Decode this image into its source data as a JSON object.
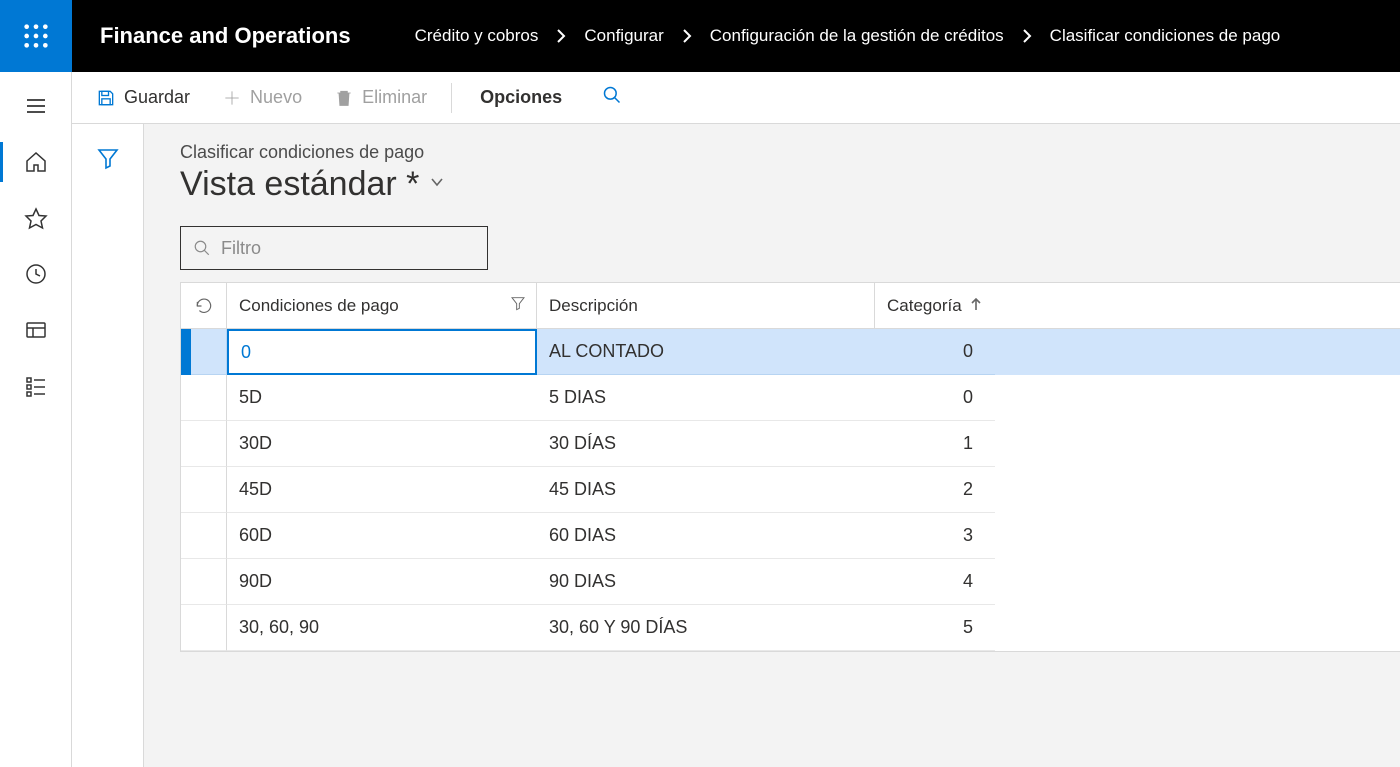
{
  "header": {
    "app_title": "Finance and Operations",
    "breadcrumbs": [
      "Crédito y cobros",
      "Configurar",
      "Configuración de la gestión de créditos",
      "Clasificar condiciones de pago"
    ]
  },
  "actions": {
    "save": "Guardar",
    "new": "Nuevo",
    "delete": "Eliminar",
    "options": "Opciones"
  },
  "page": {
    "subtitle": "Clasificar condiciones de pago",
    "view_title": "Vista estándar *",
    "filter_placeholder": "Filtro"
  },
  "grid": {
    "columns": {
      "cond": "Condiciones de pago",
      "desc": "Descripción",
      "cat": "Categoría"
    },
    "rows": [
      {
        "cond": "0",
        "desc": "AL CONTADO",
        "cat": "0"
      },
      {
        "cond": "5D",
        "desc": "5 DIAS",
        "cat": "0"
      },
      {
        "cond": "30D",
        "desc": "30 DÍAS",
        "cat": "1"
      },
      {
        "cond": "45D",
        "desc": "45 DIAS",
        "cat": "2"
      },
      {
        "cond": "60D",
        "desc": "60 DIAS",
        "cat": "3"
      },
      {
        "cond": "90D",
        "desc": "90 DIAS",
        "cat": "4"
      },
      {
        "cond": "30, 60, 90",
        "desc": "30, 60 Y 90 DÍAS",
        "cat": "5"
      }
    ],
    "selected_index": 0
  }
}
